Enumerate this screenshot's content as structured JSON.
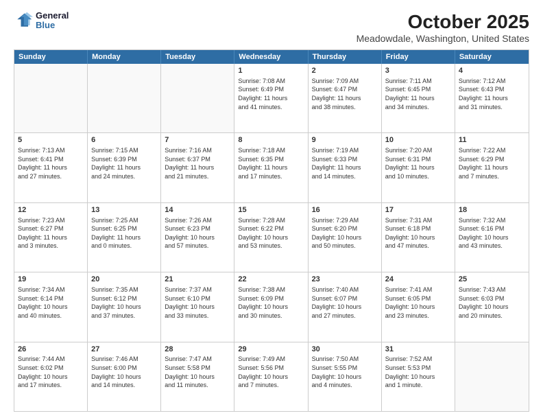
{
  "logo": {
    "line1": "General",
    "line2": "Blue"
  },
  "title": "October 2025",
  "subtitle": "Meadowdale, Washington, United States",
  "days": [
    "Sunday",
    "Monday",
    "Tuesday",
    "Wednesday",
    "Thursday",
    "Friday",
    "Saturday"
  ],
  "rows": [
    [
      {
        "num": "",
        "info": ""
      },
      {
        "num": "",
        "info": ""
      },
      {
        "num": "",
        "info": ""
      },
      {
        "num": "1",
        "info": "Sunrise: 7:08 AM\nSunset: 6:49 PM\nDaylight: 11 hours\nand 41 minutes."
      },
      {
        "num": "2",
        "info": "Sunrise: 7:09 AM\nSunset: 6:47 PM\nDaylight: 11 hours\nand 38 minutes."
      },
      {
        "num": "3",
        "info": "Sunrise: 7:11 AM\nSunset: 6:45 PM\nDaylight: 11 hours\nand 34 minutes."
      },
      {
        "num": "4",
        "info": "Sunrise: 7:12 AM\nSunset: 6:43 PM\nDaylight: 11 hours\nand 31 minutes."
      }
    ],
    [
      {
        "num": "5",
        "info": "Sunrise: 7:13 AM\nSunset: 6:41 PM\nDaylight: 11 hours\nand 27 minutes."
      },
      {
        "num": "6",
        "info": "Sunrise: 7:15 AM\nSunset: 6:39 PM\nDaylight: 11 hours\nand 24 minutes."
      },
      {
        "num": "7",
        "info": "Sunrise: 7:16 AM\nSunset: 6:37 PM\nDaylight: 11 hours\nand 21 minutes."
      },
      {
        "num": "8",
        "info": "Sunrise: 7:18 AM\nSunset: 6:35 PM\nDaylight: 11 hours\nand 17 minutes."
      },
      {
        "num": "9",
        "info": "Sunrise: 7:19 AM\nSunset: 6:33 PM\nDaylight: 11 hours\nand 14 minutes."
      },
      {
        "num": "10",
        "info": "Sunrise: 7:20 AM\nSunset: 6:31 PM\nDaylight: 11 hours\nand 10 minutes."
      },
      {
        "num": "11",
        "info": "Sunrise: 7:22 AM\nSunset: 6:29 PM\nDaylight: 11 hours\nand 7 minutes."
      }
    ],
    [
      {
        "num": "12",
        "info": "Sunrise: 7:23 AM\nSunset: 6:27 PM\nDaylight: 11 hours\nand 3 minutes."
      },
      {
        "num": "13",
        "info": "Sunrise: 7:25 AM\nSunset: 6:25 PM\nDaylight: 11 hours\nand 0 minutes."
      },
      {
        "num": "14",
        "info": "Sunrise: 7:26 AM\nSunset: 6:23 PM\nDaylight: 10 hours\nand 57 minutes."
      },
      {
        "num": "15",
        "info": "Sunrise: 7:28 AM\nSunset: 6:22 PM\nDaylight: 10 hours\nand 53 minutes."
      },
      {
        "num": "16",
        "info": "Sunrise: 7:29 AM\nSunset: 6:20 PM\nDaylight: 10 hours\nand 50 minutes."
      },
      {
        "num": "17",
        "info": "Sunrise: 7:31 AM\nSunset: 6:18 PM\nDaylight: 10 hours\nand 47 minutes."
      },
      {
        "num": "18",
        "info": "Sunrise: 7:32 AM\nSunset: 6:16 PM\nDaylight: 10 hours\nand 43 minutes."
      }
    ],
    [
      {
        "num": "19",
        "info": "Sunrise: 7:34 AM\nSunset: 6:14 PM\nDaylight: 10 hours\nand 40 minutes."
      },
      {
        "num": "20",
        "info": "Sunrise: 7:35 AM\nSunset: 6:12 PM\nDaylight: 10 hours\nand 37 minutes."
      },
      {
        "num": "21",
        "info": "Sunrise: 7:37 AM\nSunset: 6:10 PM\nDaylight: 10 hours\nand 33 minutes."
      },
      {
        "num": "22",
        "info": "Sunrise: 7:38 AM\nSunset: 6:09 PM\nDaylight: 10 hours\nand 30 minutes."
      },
      {
        "num": "23",
        "info": "Sunrise: 7:40 AM\nSunset: 6:07 PM\nDaylight: 10 hours\nand 27 minutes."
      },
      {
        "num": "24",
        "info": "Sunrise: 7:41 AM\nSunset: 6:05 PM\nDaylight: 10 hours\nand 23 minutes."
      },
      {
        "num": "25",
        "info": "Sunrise: 7:43 AM\nSunset: 6:03 PM\nDaylight: 10 hours\nand 20 minutes."
      }
    ],
    [
      {
        "num": "26",
        "info": "Sunrise: 7:44 AM\nSunset: 6:02 PM\nDaylight: 10 hours\nand 17 minutes."
      },
      {
        "num": "27",
        "info": "Sunrise: 7:46 AM\nSunset: 6:00 PM\nDaylight: 10 hours\nand 14 minutes."
      },
      {
        "num": "28",
        "info": "Sunrise: 7:47 AM\nSunset: 5:58 PM\nDaylight: 10 hours\nand 11 minutes."
      },
      {
        "num": "29",
        "info": "Sunrise: 7:49 AM\nSunset: 5:56 PM\nDaylight: 10 hours\nand 7 minutes."
      },
      {
        "num": "30",
        "info": "Sunrise: 7:50 AM\nSunset: 5:55 PM\nDaylight: 10 hours\nand 4 minutes."
      },
      {
        "num": "31",
        "info": "Sunrise: 7:52 AM\nSunset: 5:53 PM\nDaylight: 10 hours\nand 1 minute."
      },
      {
        "num": "",
        "info": ""
      }
    ]
  ]
}
